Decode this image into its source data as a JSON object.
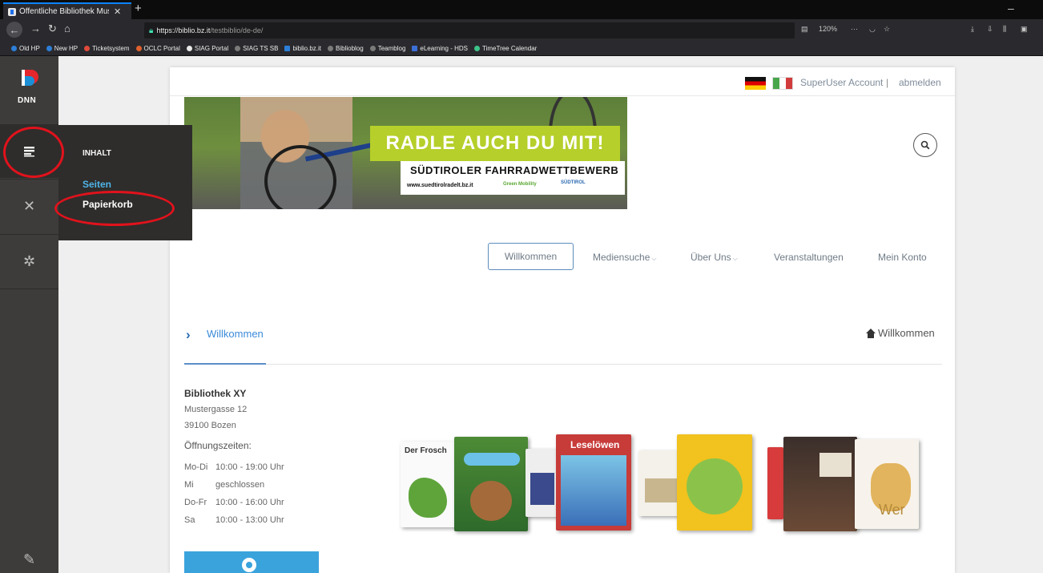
{
  "browser": {
    "tab_title": "Öffentliche Bibliothek Muster",
    "tab_close": "✕",
    "new_tab": "+",
    "url_host": "https://biblio.bz.it",
    "url_path": "/testbiblio/de-de/",
    "zoom": "120%",
    "more": "···",
    "bookmarks": [
      "Old HP",
      "New HP",
      "Ticketsystem",
      "OCLC Portal",
      "SIAG Portal",
      "SIAG TS SB",
      "biblio.bz.it",
      "Biblioblog",
      "Teamblog",
      "eLearning - HDS",
      "TimeTree Calendar"
    ]
  },
  "persona_bar": {
    "logo_text": "DNN",
    "flyout": {
      "title": "INHALT",
      "items": [
        "Seiten",
        "Papierkorb"
      ]
    }
  },
  "header": {
    "account": "SuperUser Account",
    "separator": "|",
    "logout": "abmelden"
  },
  "banner": {
    "headline": "RADLE AUCH DU MIT!",
    "subline": "SÜDTIROLER FAHRRADWETTBEWERB",
    "url": "www.suedtirolradelt.bz.it",
    "partner1": "Green Mobility",
    "partner2": "SÜDTIROL"
  },
  "menu": {
    "items": [
      "Willkommen",
      "Mediensuche",
      "Über Uns",
      "Veranstaltungen",
      "Mein Konto"
    ],
    "active_index": 0
  },
  "breadcrumb": {
    "current": "Willkommen",
    "home_label": "Willkommen"
  },
  "library": {
    "name": "Bibliothek XY",
    "street": "Mustergasse 12",
    "city": "39100 Bozen",
    "hours_title": "Öffnungszeiten:",
    "hours": [
      {
        "day": "Mo-Di",
        "time": "10:00 - 19:00 Uhr"
      },
      {
        "day": "Mi",
        "time": "geschlossen"
      },
      {
        "day": "Do-Fr",
        "time": "10:00 - 16:00 Uhr"
      },
      {
        "day": "Sa",
        "time": "10:00 - 13:00 Uhr"
      }
    ]
  },
  "books": {
    "frosch": "Der Frosch",
    "leseloewen": "Leselöwen",
    "wer": "Wer"
  },
  "colors": {
    "persona_bg": "#3d3c3a",
    "accent_blue": "#3a8ad8",
    "annotation_red": "#e1121c"
  }
}
